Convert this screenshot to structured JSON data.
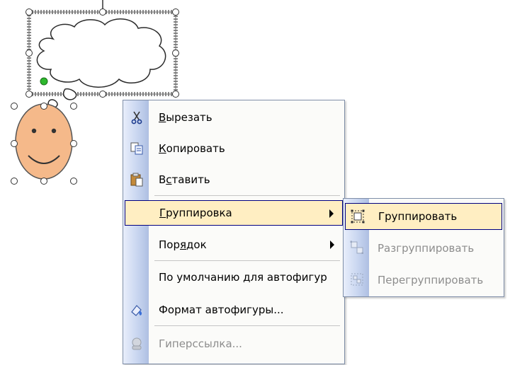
{
  "context_menu": {
    "items": [
      {
        "label": "Вырезать",
        "mnemonic_index": 0,
        "icon": "scissors-icon",
        "enabled": true
      },
      {
        "label": "Копировать",
        "mnemonic_index": 0,
        "icon": "copy-icon",
        "enabled": true
      },
      {
        "label": "Вставить",
        "mnemonic_index": 1,
        "icon": "paste-icon",
        "enabled": true
      },
      {
        "label": "Группировка",
        "mnemonic_index": 0,
        "icon": "",
        "has_submenu": true,
        "highlighted": true,
        "enabled": true
      },
      {
        "label": "Порядок",
        "mnemonic_index": 3,
        "icon": "",
        "has_submenu": true,
        "enabled": true
      },
      {
        "label": "По умолчанию для автофигур",
        "icon": "",
        "enabled": true
      },
      {
        "label": "Формат автофигуры...",
        "icon": "format-paint-icon",
        "enabled": true
      },
      {
        "label": "Гиперссылка...",
        "icon": "hyperlink-icon",
        "enabled": false
      }
    ]
  },
  "submenu": {
    "items": [
      {
        "label": "Группировать",
        "icon": "group-icon",
        "enabled": true,
        "highlighted": true
      },
      {
        "label": "Разгруппировать",
        "icon": "ungroup-icon",
        "enabled": false
      },
      {
        "label": "Перегруппировать",
        "icon": "regroup-icon",
        "enabled": false
      }
    ]
  },
  "colors": {
    "highlight_bg": "#ffeec2",
    "highlight_border": "#000080",
    "smiley_fill": "#f5b98a",
    "disabled_text": "#8d8d8d"
  }
}
